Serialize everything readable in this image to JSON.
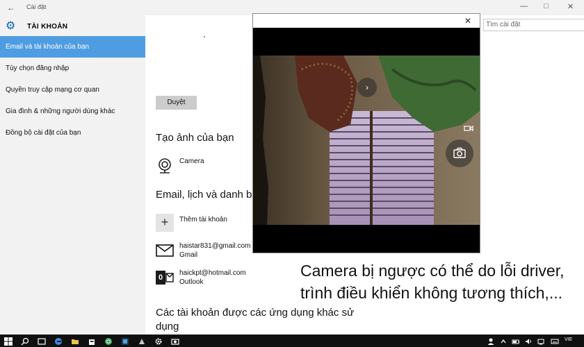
{
  "window": {
    "title": "Cài đặt",
    "back_icon": "back-arrow-icon",
    "minimize_icon": "minimize-icon",
    "maximize_icon": "maximize-icon",
    "close_icon": "close-icon"
  },
  "sidebar": {
    "section_title": "TÀI KHOẢN",
    "items": [
      {
        "label": "Email và tài khoản của bạn",
        "active": true
      },
      {
        "label": "Tùy chọn đăng nhập"
      },
      {
        "label": "Quyền truy cập mạng cơ quan"
      },
      {
        "label": "Gia đình & những người dùng khác"
      },
      {
        "label": "Đồng bộ cài đặt của bạn"
      }
    ]
  },
  "search": {
    "placeholder": "Tìm cài đặt"
  },
  "main": {
    "browse_label": "Duyệt",
    "create_heading": "Tạo ảnh của bạn",
    "camera_label": "Camera",
    "email_heading": "Email, lịch và danh bạ",
    "add_account_label": "Thêm tài khoản",
    "accounts": [
      {
        "email": "haistar831@gmail.com",
        "provider": "Gmail",
        "icon": "mail-icon"
      },
      {
        "email": "haickpt@hotmail.com",
        "provider": "Outlook",
        "icon": "outlook-icon"
      }
    ],
    "apps_heading": "Các tài khoản được các ứng dụng khác sử dụng"
  },
  "camera_popup": {
    "close_icon": "close-icon",
    "next_icon": "chevron-right-icon",
    "video_icon": "video-mode-icon",
    "shutter_icon": "camera-shutter-icon"
  },
  "caption": {
    "line1": "Camera bị ngược có thể do lỗi driver,",
    "line2": "trình điều khiển không tương thích,..."
  },
  "taskbar": {
    "language": "VIE",
    "colors": {
      "background": "#101010",
      "accent": "#4e9de2"
    }
  }
}
